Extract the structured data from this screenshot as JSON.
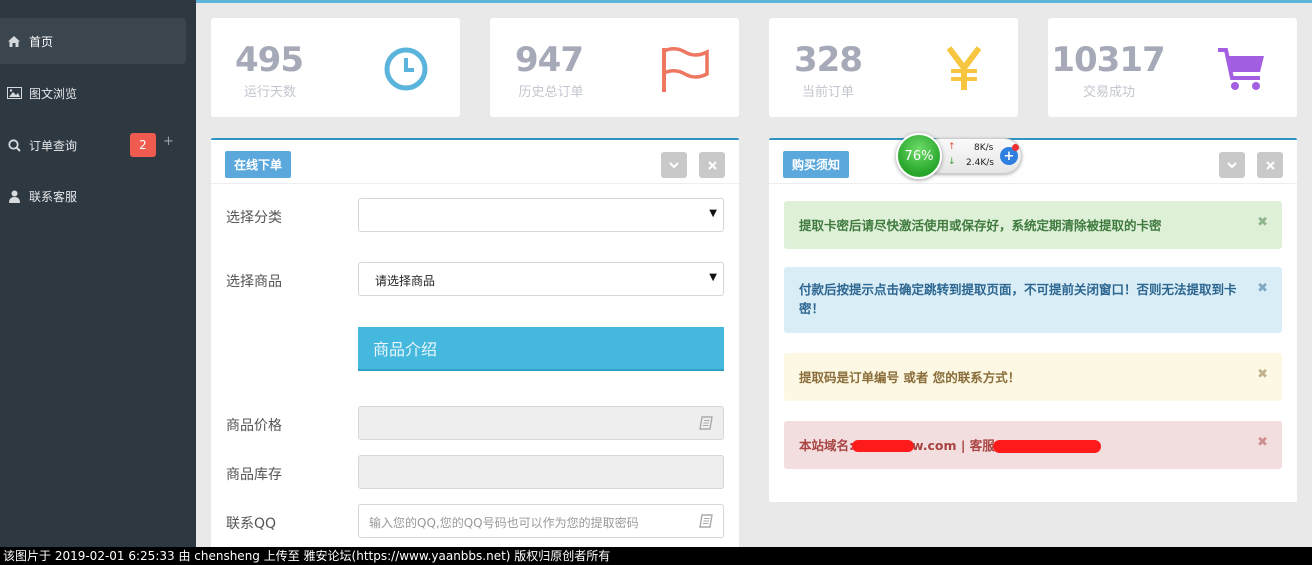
{
  "sidebar": {
    "items": [
      {
        "label": "首页",
        "icon": "home-icon"
      },
      {
        "label": "图文浏览",
        "icon": "image-icon"
      },
      {
        "label": "订单查询",
        "icon": "search-icon",
        "badge": "2",
        "extra": "+"
      },
      {
        "label": "联系客服",
        "icon": "user-icon"
      }
    ]
  },
  "stats": [
    {
      "value": "495",
      "label": "运行天数",
      "icon": "clock-icon",
      "color": "#5ab4dc"
    },
    {
      "value": "947",
      "label": "历史总订单",
      "icon": "flag-icon",
      "color": "#ed7760"
    },
    {
      "value": "328",
      "label": "当前订单",
      "icon": "yen-icon",
      "color": "#f6c640"
    },
    {
      "value": "10317",
      "label": "交易成功",
      "icon": "cart-icon",
      "color": "#a35ee2"
    }
  ],
  "order_panel": {
    "title": "在线下单",
    "fields": {
      "category_label": "选择分类",
      "category_value": "",
      "product_label": "选择商品",
      "product_value": "请选择商品",
      "intro_label": "商品介绍",
      "price_label": "商品价格",
      "stock_label": "商品库存",
      "qq_label": "联系QQ",
      "qq_placeholder": "输入您的QQ,您的QQ号码也可以作为您的提取密码"
    }
  },
  "notice_panel": {
    "title": "购买须知",
    "alerts": [
      "提取卡密后请尽快激活使用或保存好，系统定期清除被提取的卡密",
      "付款后按提示点击确定跳转到提取页面，不可提前关闭窗口！否则无法提取到卡密！",
      "提取码是订单编号 或者 您的联系方式！",
      {
        "prefix": "本站域名:",
        "mid": "w.com | 客服"
      }
    ],
    "close_glyph": "✖"
  },
  "net_widget": {
    "percent": "76%",
    "up": "8K/s",
    "down": "2.4K/s"
  },
  "footer": "该图片于 2019-02-01 6:25:33 由 chensheng 上传至 雅安论坛(https://www.yaanbbs.net) 版权归原创者所有"
}
